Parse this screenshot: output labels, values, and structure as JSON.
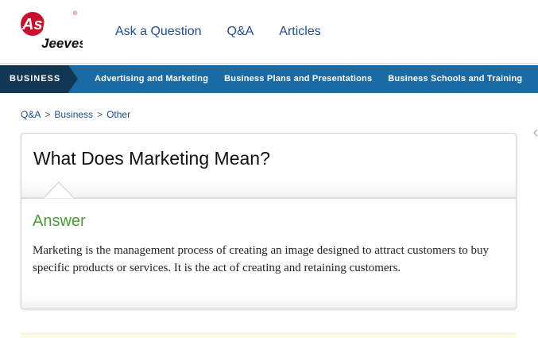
{
  "brand": {
    "logo_top": "Ask",
    "logo_bottom": "Jeeves",
    "trademark": "®",
    "logo_color": "#c8102e"
  },
  "top_nav": {
    "items": [
      "Ask a Question",
      "Q&A",
      "Articles"
    ]
  },
  "category_bar": {
    "active": "BUSINESS",
    "items": [
      "Advertising and Marketing",
      "Business Plans and Presentations",
      "Business Schools and Training"
    ],
    "bar_color": "#1a6ba3",
    "active_color": "#123753"
  },
  "breadcrumb": {
    "items": [
      "Q&A",
      "Business",
      "Other"
    ],
    "separator": ">"
  },
  "question": {
    "title": "What Does Marketing Mean?"
  },
  "answer": {
    "label": "Answer",
    "label_color": "#4a9a35",
    "text": "Marketing is the management process of creating an image designed to attract customers to buy specific products or services. It is the act of creating and retaining customers."
  }
}
